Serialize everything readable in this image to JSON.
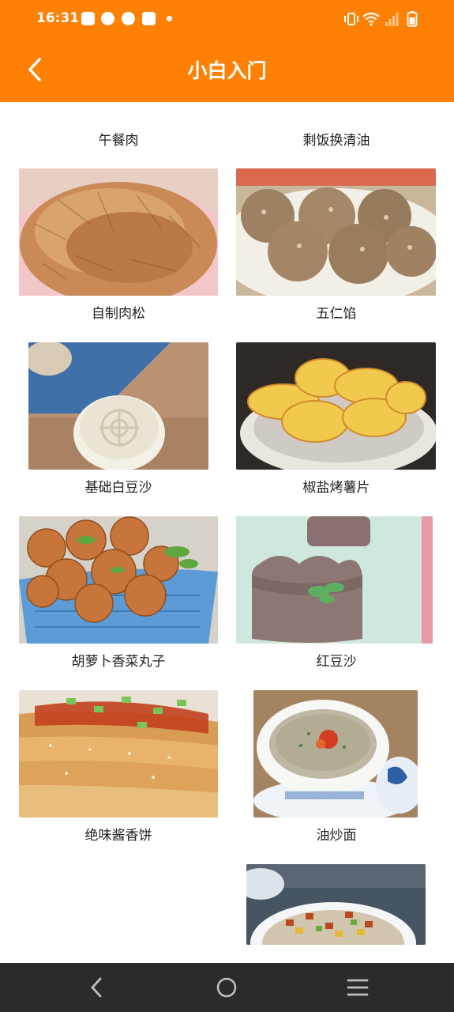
{
  "status_bar": {
    "time": "16:31",
    "notification_icons": [
      "mail-icon",
      "clock-icon",
      "clock-icon",
      "mail-icon"
    ],
    "system_icons": [
      "vibrate-icon",
      "wifi-icon",
      "signal-icon",
      "battery-icon"
    ]
  },
  "header": {
    "title": "小白入门",
    "back_icon": "chevron-left-icon",
    "background": "#FE8104"
  },
  "recipes": [
    {
      "name": "午餐肉"
    },
    {
      "name": "剩饭换清油"
    },
    {
      "name": "自制肉松"
    },
    {
      "name": "五仁馅"
    },
    {
      "name": "基础白豆沙"
    },
    {
      "name": "椒盐烤薯片"
    },
    {
      "name": "胡萝卜香菜丸子"
    },
    {
      "name": "红豆沙"
    },
    {
      "name": "绝味酱香饼"
    },
    {
      "name": "油炒面"
    }
  ],
  "nav_bar": {
    "buttons": [
      "back-nav-icon",
      "home-nav-icon",
      "menu-nav-icon"
    ],
    "background": "#2B2B2B"
  }
}
